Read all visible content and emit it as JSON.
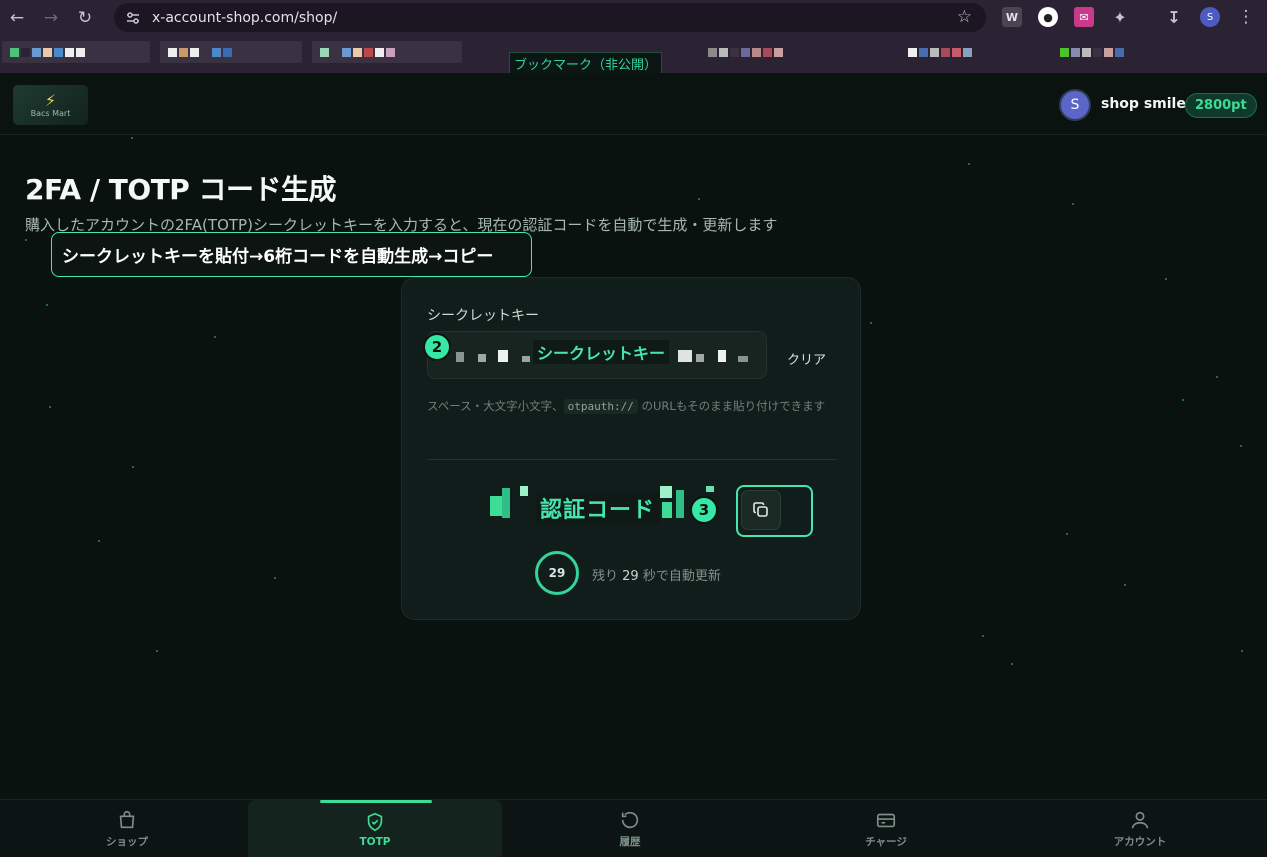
{
  "browser": {
    "url": "x-account-shop.com/shop/",
    "bookmark_tooltip": "ブックマーク（非公開）",
    "profile_initial": "S",
    "extensions": [
      "W"
    ]
  },
  "header": {
    "logo_text": "Bacs Mart",
    "avatar_initial": "S",
    "username": "shop smile",
    "points": "2800pt"
  },
  "page": {
    "title": "2FA / TOTP コード生成",
    "description": "購入したアカウントの2FA(TOTP)シークレットキーを入力すると、現在の認証コードを自動で生成・更新します",
    "callout": "シークレットキーを貼付→6桁コードを自動生成→コピー"
  },
  "card": {
    "field_label": "シークレットキー",
    "secret_overlay": "シークレットキー",
    "clear_label": "クリア",
    "hint_before": "スペース・大文字小文字、",
    "hint_code": "otpauth://",
    "hint_after": " のURLもそのまま貼り付けできます",
    "code_overlay": "認証コード",
    "step2": "2",
    "step3": "3",
    "timer_value": "29",
    "timer_prefix": "残り ",
    "timer_seconds": "29",
    "timer_suffix": " 秒で自動更新"
  },
  "bottom_nav": {
    "tabs": [
      {
        "label": "ショップ",
        "active": false
      },
      {
        "label": "TOTP",
        "active": true
      },
      {
        "label": "履歴",
        "active": false
      },
      {
        "label": "チャージ",
        "active": false
      },
      {
        "label": "アカウント",
        "active": false
      }
    ]
  },
  "colors": {
    "accent": "#3ddc97",
    "callout_border": "#46e6b0",
    "background": "#0a1210",
    "card": "#111d1a"
  }
}
